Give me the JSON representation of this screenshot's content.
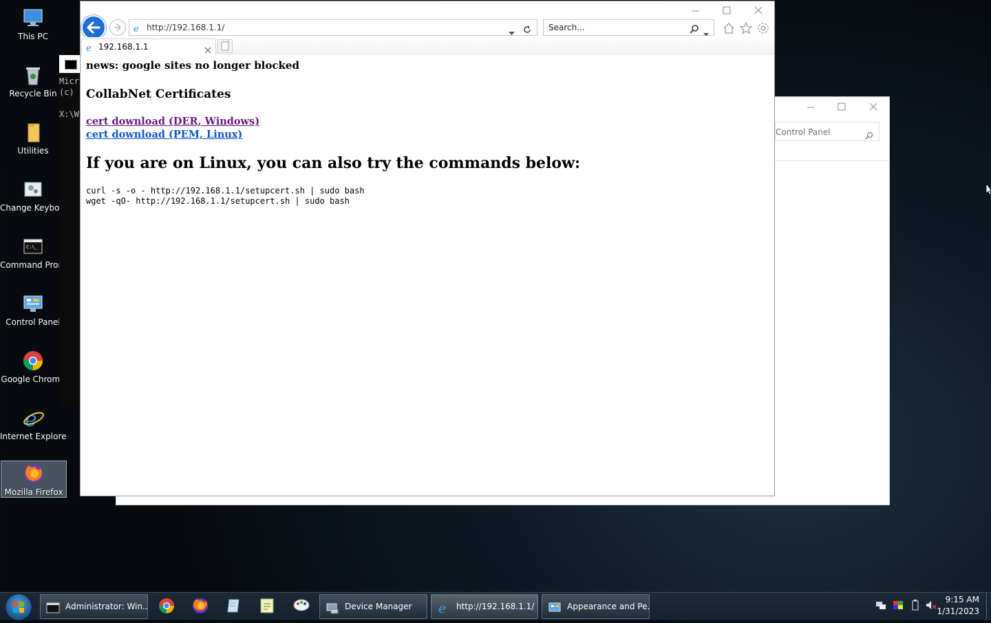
{
  "desktop": {
    "icons": [
      {
        "label": "This PC"
      },
      {
        "label": "Recycle Bin"
      },
      {
        "label": "Utilities"
      },
      {
        "label": "Change Keyboard Layout"
      },
      {
        "label": "Command Prompt"
      },
      {
        "label": "Control Panel"
      },
      {
        "label": "Google Chrome"
      },
      {
        "label": "Internet Explorer"
      },
      {
        "label": "Mozilla Firefox"
      }
    ]
  },
  "cmd": {
    "lines": [
      "Micr",
      "(c)",
      "",
      "X:\\W"
    ]
  },
  "control_panel": {
    "search_placeholder": "Control Panel"
  },
  "ie": {
    "address": "http://192.168.1.1/",
    "search_placeholder": "Search...",
    "tab_title": "192.168.1.1"
  },
  "page": {
    "news": "news: google sites no longer blocked",
    "heading": "CollabNet Certificates",
    "link_der": "cert download (DER, Windows)",
    "link_pem": "cert download (PEM, Linux)",
    "linux_heading": "If you are on Linux, you can also try the commands below:",
    "commands": "curl -s -o - http://192.168.1.1/setupcert.sh | sudo bash\nwget -qO- http://192.168.1.1/setupcert.sh | sudo bash"
  },
  "taskbar": {
    "buttons": [
      {
        "label": "Administrator: Win..."
      },
      {
        "label": "Device Manager"
      },
      {
        "label": "http://192.168.1.1/ ..."
      },
      {
        "label": "Appearance and Pe..."
      }
    ],
    "time": "9:15 AM",
    "date": "1/31/2023"
  },
  "colors": {
    "link_visited": "#681a7e",
    "link_unvisited": "#1055c8",
    "back_button": "#1f6fd1"
  }
}
